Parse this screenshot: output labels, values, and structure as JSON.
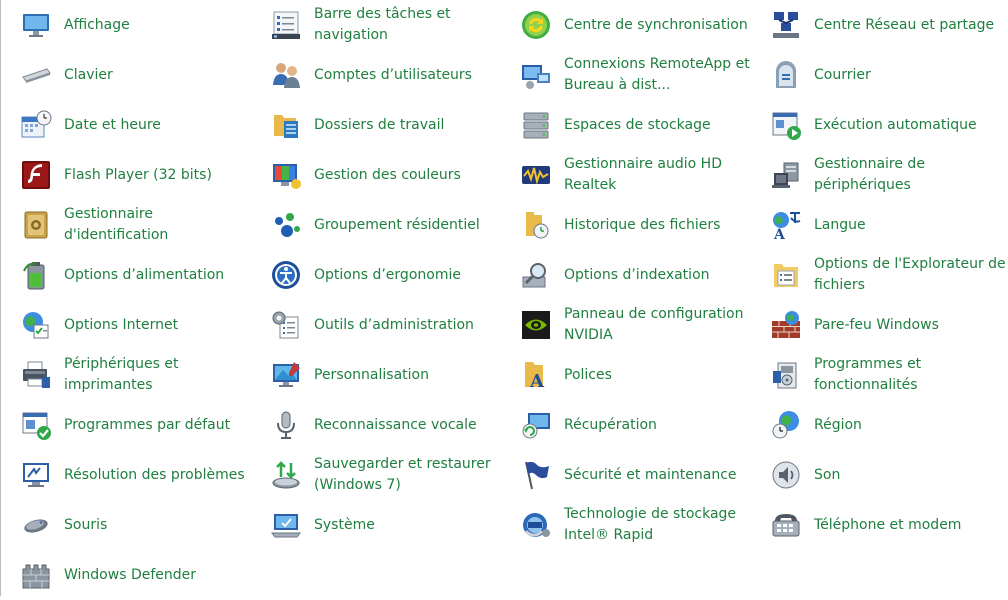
{
  "items": [
    {
      "label": "Affichage",
      "icon": "monitor-icon"
    },
    {
      "label": "Barre des tâches et navigation",
      "icon": "taskbar-icon"
    },
    {
      "label": "Centre de synchronisation",
      "icon": "sync-icon"
    },
    {
      "label": "Centre Réseau et partage",
      "icon": "network-icon"
    },
    {
      "label": "Clavier",
      "icon": "keyboard-icon"
    },
    {
      "label": "Comptes d’utilisateurs",
      "icon": "users-icon"
    },
    {
      "label": "Connexions RemoteApp et Bureau à dist...",
      "icon": "remote-desktop-icon"
    },
    {
      "label": "Courrier",
      "icon": "mail-icon"
    },
    {
      "label": "Date et heure",
      "icon": "calendar-clock-icon"
    },
    {
      "label": "Dossiers de travail",
      "icon": "work-folders-icon"
    },
    {
      "label": "Espaces de stockage",
      "icon": "storage-icon"
    },
    {
      "label": "Exécution automatique",
      "icon": "autoplay-icon"
    },
    {
      "label": "Flash Player (32 bits)",
      "icon": "flash-icon"
    },
    {
      "label": "Gestion des couleurs",
      "icon": "color-management-icon"
    },
    {
      "label": "Gestionnaire audio HD Realtek",
      "icon": "audio-icon"
    },
    {
      "label": "Gestionnaire de périphériques",
      "icon": "device-manager-icon"
    },
    {
      "label": "Gestionnaire d'identification",
      "icon": "credential-vault-icon"
    },
    {
      "label": "Groupement résidentiel",
      "icon": "homegroup-icon"
    },
    {
      "label": "Historique des fichiers",
      "icon": "file-history-icon"
    },
    {
      "label": "Langue",
      "icon": "language-icon"
    },
    {
      "label": "Options d’alimentation",
      "icon": "battery-icon"
    },
    {
      "label": "Options d’ergonomie",
      "icon": "ease-of-access-icon"
    },
    {
      "label": "Options d’indexation",
      "icon": "indexing-icon"
    },
    {
      "label": "Options de l'Explorateur de fichiers",
      "icon": "folder-options-icon"
    },
    {
      "label": "Options Internet",
      "icon": "internet-options-icon"
    },
    {
      "label": "Outils d’administration",
      "icon": "admin-tools-icon"
    },
    {
      "label": "Panneau de configuration NVIDIA",
      "icon": "nvidia-icon"
    },
    {
      "label": "Pare-feu Windows",
      "icon": "firewall-icon"
    },
    {
      "label": "Périphériques et imprimantes",
      "icon": "printer-icon"
    },
    {
      "label": "Personnalisation",
      "icon": "personalization-icon"
    },
    {
      "label": "Polices",
      "icon": "fonts-icon"
    },
    {
      "label": "Programmes et fonctionnalités",
      "icon": "programs-icon"
    },
    {
      "label": "Programmes par défaut",
      "icon": "default-programs-icon"
    },
    {
      "label": "Reconnaissance vocale",
      "icon": "microphone-icon"
    },
    {
      "label": "Récupération",
      "icon": "recovery-icon"
    },
    {
      "label": "Région",
      "icon": "region-icon"
    },
    {
      "label": "Résolution des problèmes",
      "icon": "troubleshooting-icon"
    },
    {
      "label": "Sauvegarder et restaurer (Windows 7)",
      "icon": "backup-icon"
    },
    {
      "label": "Sécurité et maintenance",
      "icon": "flag-icon"
    },
    {
      "label": "Son",
      "icon": "speaker-icon"
    },
    {
      "label": "Souris",
      "icon": "mouse-icon"
    },
    {
      "label": "Système",
      "icon": "system-icon"
    },
    {
      "label": "Technologie de stockage Intel® Rapid",
      "icon": "intel-rst-icon"
    },
    {
      "label": "Téléphone et modem",
      "icon": "phone-modem-icon"
    },
    {
      "label": "Windows Defender",
      "icon": "defender-icon"
    }
  ],
  "colors": {
    "label": "#1f7f3f",
    "border": "#bdbdbd",
    "background": "#ffffff"
  }
}
